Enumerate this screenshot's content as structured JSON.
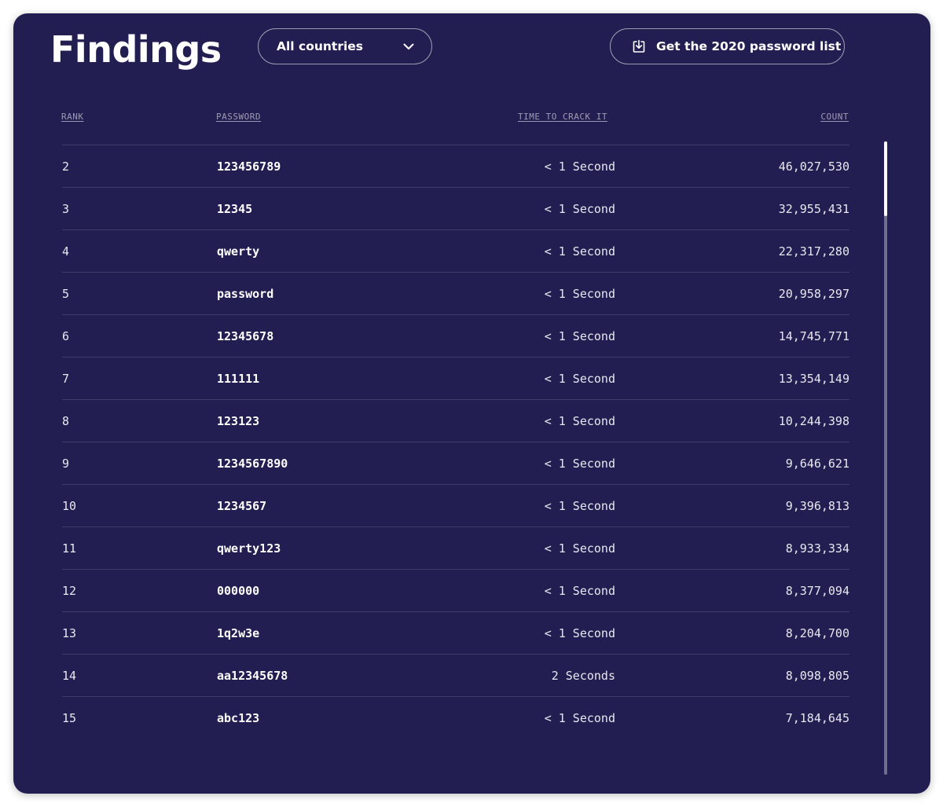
{
  "header": {
    "title": "Findings",
    "country_select": {
      "selected": "All countries",
      "icon": "chevron-down-icon"
    },
    "download_button": {
      "label": "Get the 2020 password list",
      "icon": "download-icon"
    }
  },
  "table": {
    "columns": {
      "rank": "RANK",
      "password": "PASSWORD",
      "time": "TIME TO CRACK IT",
      "count": "COUNT"
    },
    "rows": [
      {
        "rank": "2",
        "password": "123456789",
        "time": "< 1 Second",
        "count": "46,027,530"
      },
      {
        "rank": "3",
        "password": "12345",
        "time": "< 1 Second",
        "count": "32,955,431"
      },
      {
        "rank": "4",
        "password": "qwerty",
        "time": "< 1 Second",
        "count": "22,317,280"
      },
      {
        "rank": "5",
        "password": "password",
        "time": "< 1 Second",
        "count": "20,958,297"
      },
      {
        "rank": "6",
        "password": "12345678",
        "time": "< 1 Second",
        "count": "14,745,771"
      },
      {
        "rank": "7",
        "password": "111111",
        "time": "< 1 Second",
        "count": "13,354,149"
      },
      {
        "rank": "8",
        "password": "123123",
        "time": "< 1 Second",
        "count": "10,244,398"
      },
      {
        "rank": "9",
        "password": "1234567890",
        "time": "< 1 Second",
        "count": "9,646,621"
      },
      {
        "rank": "10",
        "password": "1234567",
        "time": "< 1 Second",
        "count": "9,396,813"
      },
      {
        "rank": "11",
        "password": "qwerty123",
        "time": "< 1 Second",
        "count": "8,933,334"
      },
      {
        "rank": "12",
        "password": "000000",
        "time": "< 1 Second",
        "count": "8,377,094"
      },
      {
        "rank": "13",
        "password": "1q2w3e",
        "time": "< 1 Second",
        "count": "8,204,700"
      },
      {
        "rank": "14",
        "password": "aa12345678",
        "time": "2 Seconds",
        "count": "8,098,805"
      },
      {
        "rank": "15",
        "password": "abc123",
        "time": "< 1 Second",
        "count": "7,184,645"
      }
    ]
  },
  "colors": {
    "background": "#231e52",
    "text": "#ffffff"
  }
}
